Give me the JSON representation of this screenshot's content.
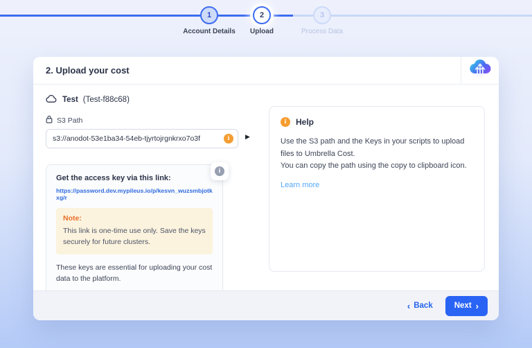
{
  "stepper": {
    "steps": [
      {
        "number": "1",
        "label": "Account Details",
        "state": "done"
      },
      {
        "number": "2",
        "label": "Upload",
        "state": "active"
      },
      {
        "number": "3",
        "label": "Process Data",
        "state": "pending"
      }
    ]
  },
  "card": {
    "title": "2. Upload your cost",
    "account": {
      "name": "Test",
      "id": "(Test-f88c68)"
    },
    "s3": {
      "label": "S3 Path",
      "value": "s3://anodot-53e1ba34-54eb-tjyrtojrgnkrxo7o3f"
    },
    "access_key_box": {
      "title": "Get the access key via this link:",
      "link": "https://password.dev.mypileus.io/p/kesvn_wuzsmbjotkxg/r",
      "note_label": "Note:",
      "note_text": "This link is one-time use only. Save the keys securely for future clusters.",
      "footer_text": "These keys are essential for uploading your cost data to the platform."
    },
    "help": {
      "title": "Help",
      "line1": "Use the S3 path and the Keys in your scripts to upload files to Umbrella Cost.",
      "line2": "You can copy the path using the copy to clipboard icon.",
      "link_label": "Learn more"
    },
    "footer": {
      "back_label": "Back",
      "next_label": "Next"
    }
  },
  "icons": {
    "info": "i",
    "expander": "▶",
    "back_chevron": "‹",
    "next_chevron": "›"
  },
  "colors": {
    "accent_blue": "#2a64f5",
    "stepper_blue": "#3d6cf0",
    "orange_info": "#f59d31",
    "note_orange": "#e8702a",
    "link_blue": "#2f6bdf",
    "learn_more_blue": "#54a8f5"
  }
}
